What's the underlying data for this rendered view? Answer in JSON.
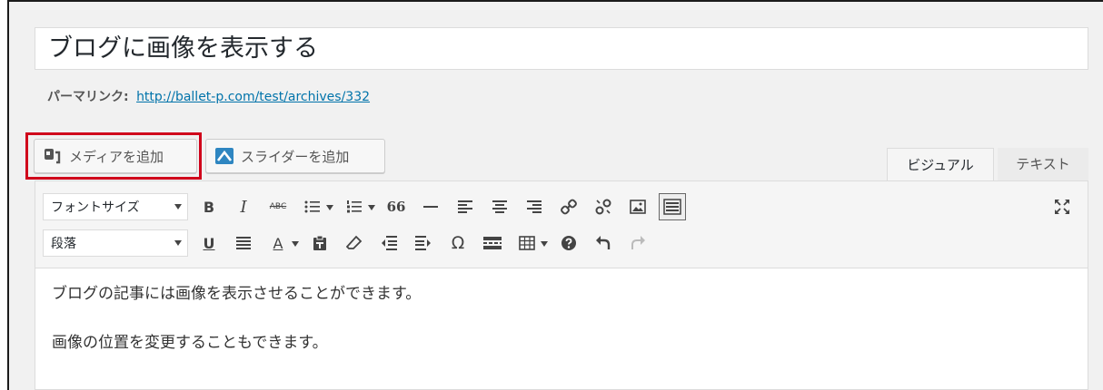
{
  "post": {
    "title": "ブログに画像を表示する",
    "permalink_label": "パーマリンク:",
    "permalink_url": "http://ballet-p.com/test/archives/332"
  },
  "buttons": {
    "add_media": "メディアを追加",
    "add_slider": "スライダーを追加"
  },
  "tabs": {
    "visual": "ビジュアル",
    "text": "テキスト"
  },
  "toolbar": {
    "font_size": "フォントサイズ",
    "format": "段落",
    "bold": "B",
    "italic": "I",
    "strikethrough": "ABC",
    "blockquote": "66",
    "omega": "Ω",
    "underline": "U",
    "text_color": "A"
  },
  "content": {
    "paragraphs": [
      "ブログの記事には画像を表示させることができます。",
      "画像の位置を変更することもできます。"
    ]
  },
  "colors": {
    "highlight": "#d0021b",
    "link": "#0073aa",
    "slider_icon": "#2e86c1"
  }
}
